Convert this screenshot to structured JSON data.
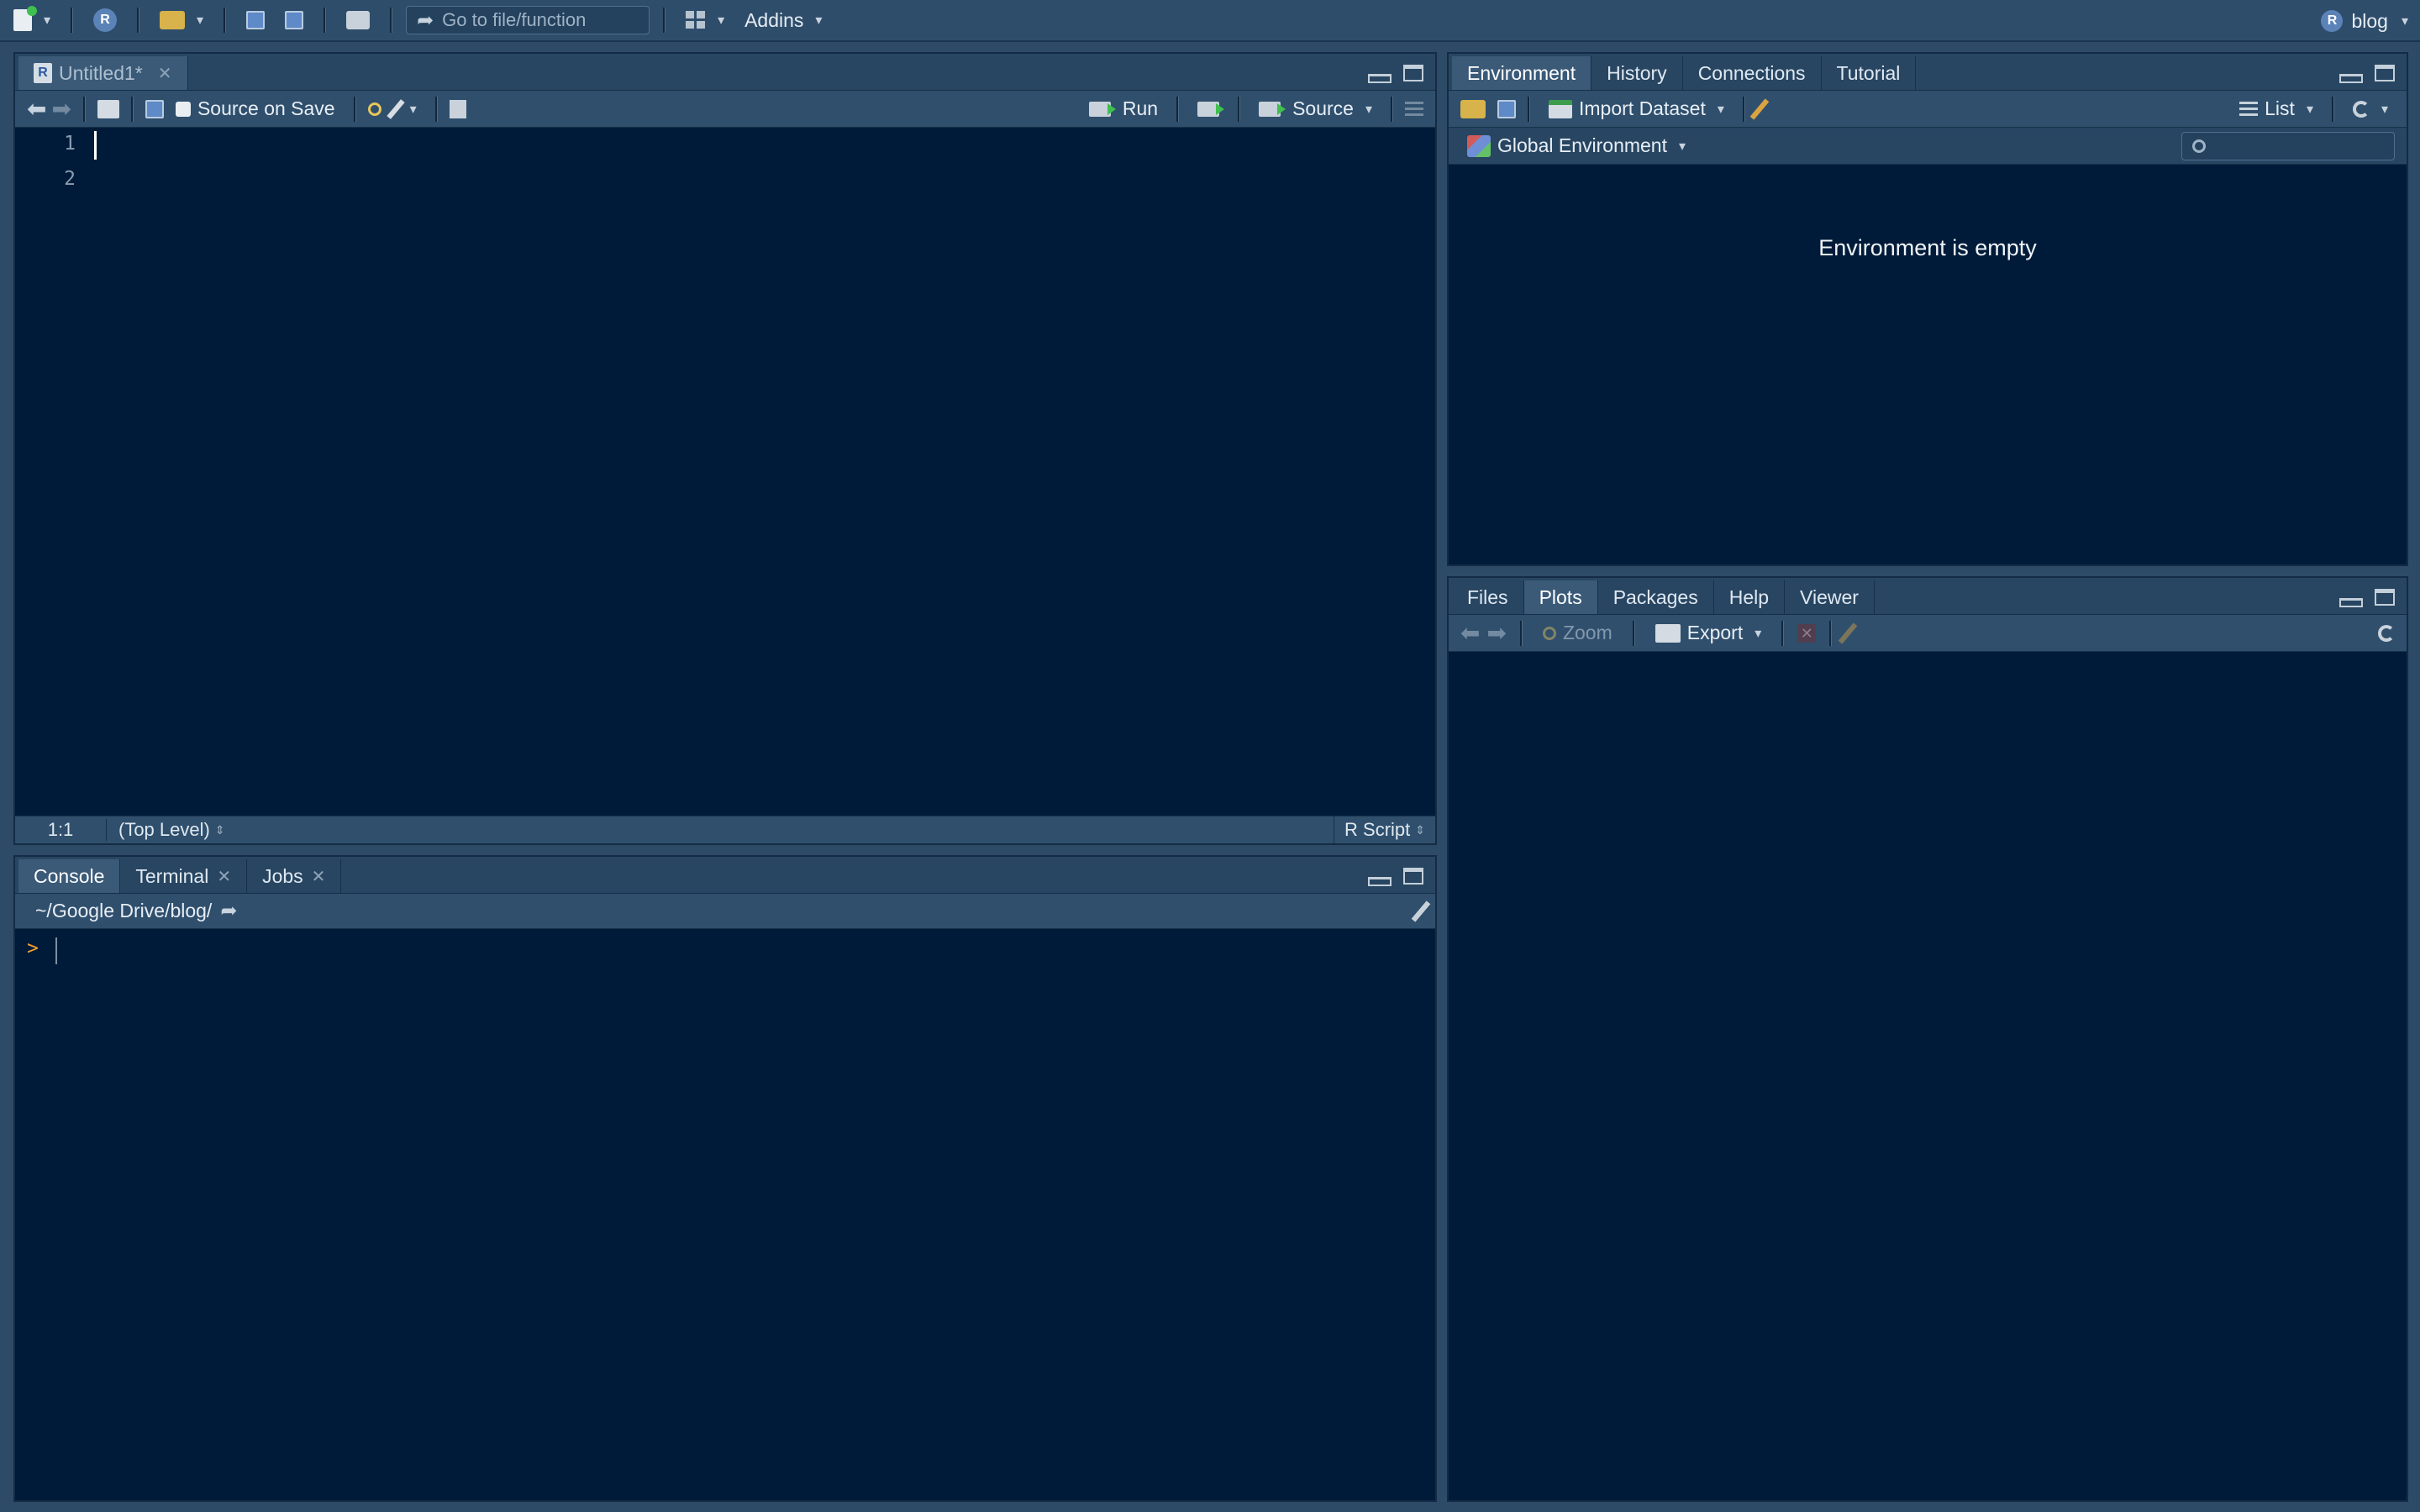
{
  "toolbar": {
    "goto_placeholder": "Go to file/function",
    "addins_label": "Addins",
    "project_label": "blog"
  },
  "source_pane": {
    "tab_label": "Untitled1*",
    "source_on_save_label": "Source on Save",
    "run_label": "Run",
    "source_label": "Source",
    "line_numbers": [
      "1",
      "2"
    ],
    "status_position": "1:1",
    "status_scope": "(Top Level)",
    "status_filetype": "R Script"
  },
  "console_pane": {
    "tabs": [
      {
        "label": "Console"
      },
      {
        "label": "Terminal"
      },
      {
        "label": "Jobs"
      }
    ],
    "path": "~/Google Drive/blog/",
    "prompt": ">"
  },
  "env_pane": {
    "tabs": [
      {
        "label": "Environment"
      },
      {
        "label": "History"
      },
      {
        "label": "Connections"
      },
      {
        "label": "Tutorial"
      }
    ],
    "import_dataset_label": "Import Dataset",
    "view_mode_label": "List",
    "global_env_label": "Global Environment",
    "empty_message": "Environment is empty"
  },
  "files_pane": {
    "tabs": [
      {
        "label": "Files"
      },
      {
        "label": "Plots"
      },
      {
        "label": "Packages"
      },
      {
        "label": "Help"
      },
      {
        "label": "Viewer"
      }
    ],
    "zoom_label": "Zoom",
    "export_label": "Export"
  },
  "colors": {
    "editor_bg": "#001b39",
    "chrome_bg": "#2d4a66",
    "prompt": "#f0a030"
  }
}
